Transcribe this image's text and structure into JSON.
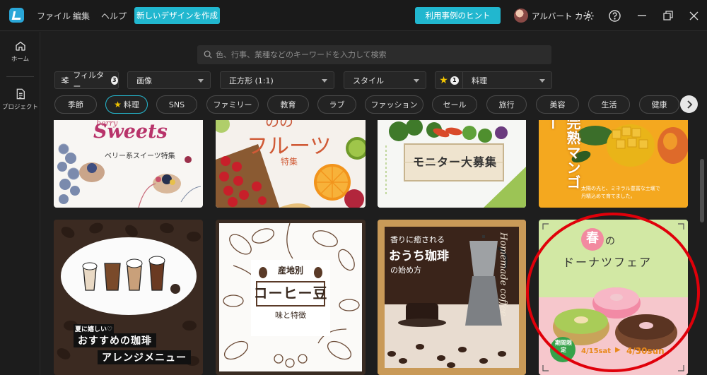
{
  "titlebar": {
    "menus": [
      "ファイル",
      "編集",
      "ヘルプ"
    ],
    "create_button": "新しいデザインを作成",
    "hint_button": "利用事例のヒント",
    "username": "アルバート カナ"
  },
  "sidebar": {
    "home": "ホーム",
    "projects": "プロジェクト"
  },
  "search": {
    "placeholder": "色、行事、業種などのキーワードを入力して検索"
  },
  "filters": {
    "filter_label": "フィルター",
    "filter_count": "3",
    "type": "画像",
    "size": "正方形 (1:1)",
    "style": "スタイル",
    "favorite_count": "1",
    "category": "料理"
  },
  "chips": [
    "季節",
    "料理",
    "SNS",
    "ファミリー",
    "教育",
    "ラブ",
    "ファッション",
    "セール",
    "旅行",
    "美容",
    "生活",
    "健康"
  ],
  "cards": {
    "sweets": {
      "script": "berry",
      "title": "Sweets",
      "subtitle": "ベリー系スイーツ特集"
    },
    "fruits": {
      "top": "のの",
      "title": "フルーツ",
      "sub": "特集"
    },
    "monitor": {
      "title": "モニター大募集"
    },
    "mango": {
      "title": "完熟マンゴー",
      "body": "太陽の光と、ミネラル豊富な土壌で\n丹精込めて育てました。"
    },
    "arrange": {
      "small": "夏に嬉しい♡",
      "title": "おすすめの珈琲",
      "sub": "アレンジメニュー"
    },
    "beans": {
      "top": "産地別",
      "title": "コーヒー豆",
      "sub": "味と特徴"
    },
    "ouchi": {
      "line1": "香りに癒される",
      "line2": "おうち珈琲",
      "line3": "の始め方",
      "vertical": "Homemade coffee"
    },
    "donut": {
      "spring": "春",
      "no": "の",
      "title": "ドーナツフェア",
      "badge": "期間限定",
      "date1": "4/15sat",
      "date2": "4/30sun"
    }
  },
  "colors": {
    "accent": "#21b7cf",
    "annotation": "#e0000a"
  }
}
